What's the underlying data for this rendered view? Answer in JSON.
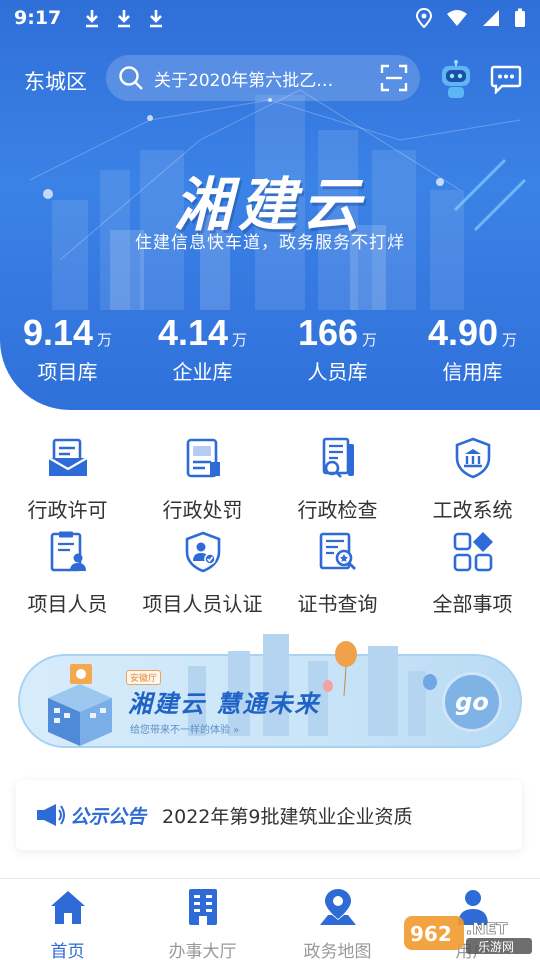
{
  "status_bar": {
    "time": "9:17",
    "icons": [
      "download-icon",
      "download-icon",
      "download-icon",
      "location-icon",
      "wifi-icon",
      "signal-icon",
      "battery-icon"
    ]
  },
  "header": {
    "city": "东城区",
    "search_text": "关于2020年第六批乙级…",
    "icons": [
      "search-icon",
      "scan-icon",
      "robot-icon",
      "message-icon"
    ]
  },
  "hero": {
    "brand": "湘建云",
    "slogan": "住建信息快车道，政务服务不打烊"
  },
  "stats": [
    {
      "value": "9.14",
      "unit": "万",
      "label": "项目库"
    },
    {
      "value": "4.14",
      "unit": "万",
      "label": "企业库"
    },
    {
      "value": "166",
      "unit": "万",
      "label": "人员库"
    },
    {
      "value": "4.90",
      "unit": "万",
      "label": "信用库"
    }
  ],
  "grid": [
    {
      "label": "行政许可",
      "icon": "license-icon"
    },
    {
      "label": "行政处罚",
      "icon": "penalty-icon"
    },
    {
      "label": "行政检查",
      "icon": "inspection-icon"
    },
    {
      "label": "工改系统",
      "icon": "system-shield-icon"
    },
    {
      "label": "项目人员",
      "icon": "project-staff-icon"
    },
    {
      "label": "项目人员认证",
      "icon": "staff-certify-icon"
    },
    {
      "label": "证书查询",
      "icon": "certificate-search-icon"
    },
    {
      "label": "全部事项",
      "icon": "all-items-icon"
    }
  ],
  "banner": {
    "tag": "安徽厅",
    "title": "湘建云  慧通未来",
    "subtitle": "给您带来不一样的体验 »",
    "button": "go"
  },
  "notice": {
    "tag": "公示公告",
    "text": "2022年第9批建筑业企业资质"
  },
  "bottom_nav": [
    {
      "label": "首页",
      "icon": "home-icon",
      "active": true
    },
    {
      "label": "办事大厅",
      "icon": "office-building-icon",
      "active": false
    },
    {
      "label": "政务地图",
      "icon": "map-pin-icon",
      "active": false
    },
    {
      "label": "用户",
      "icon": "user-icon",
      "active": false
    }
  ],
  "watermark": {
    "text": "962.NET",
    "subtext": "乐游网"
  },
  "colors": {
    "primary": "#2e6bd6",
    "hero": "#3b82e6",
    "inactive": "#999999"
  }
}
